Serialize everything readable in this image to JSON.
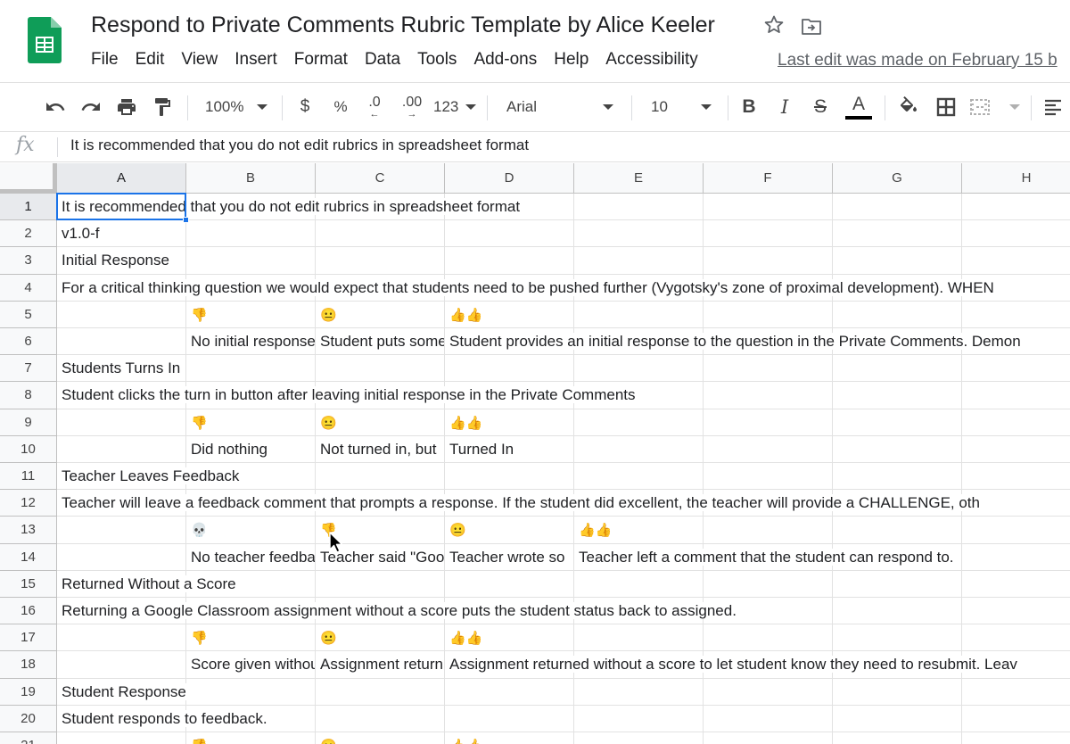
{
  "app": {
    "title": "Respond to Private Comments Rubric Template by Alice Keeler",
    "menu": [
      "File",
      "Edit",
      "View",
      "Insert",
      "Format",
      "Data",
      "Tools",
      "Add-ons",
      "Help",
      "Accessibility"
    ],
    "last_edit": "Last edit was made on February 15 b"
  },
  "toolbar": {
    "zoom": "100%",
    "currency": "$",
    "percent": "%",
    "decrease_decimal": ".0",
    "increase_decimal": ".00",
    "more_formats": "123",
    "font": "Arial",
    "font_size": "10",
    "bold": "B",
    "italic": "I",
    "strike": "S",
    "text_color_glyph": "A"
  },
  "formula_bar": {
    "fx": "fx",
    "value": "It is recommended that you do not edit rubrics in spreadsheet format"
  },
  "grid": {
    "columns": [
      "A",
      "B",
      "C",
      "D",
      "E",
      "F",
      "G",
      "H"
    ],
    "selected_column": "A",
    "selected_row": "1",
    "rows": [
      {
        "n": "1",
        "cells": [
          {
            "col": 0,
            "text": "It is recommended that you do not edit rubrics in spreadsheet format",
            "overflow": true
          }
        ]
      },
      {
        "n": "2",
        "cells": [
          {
            "col": 0,
            "text": "v1.0-f",
            "overflow": true
          }
        ]
      },
      {
        "n": "3",
        "cells": [
          {
            "col": 0,
            "text": "Initial Response",
            "overflow": true
          }
        ]
      },
      {
        "n": "4",
        "cells": [
          {
            "col": 0,
            "text": "For a critical thinking question we would expect that students need to be pushed further (Vygotsky's zone of proximal development). WHEN",
            "overflow": true
          }
        ]
      },
      {
        "n": "5",
        "cells": [
          {
            "col": 1,
            "text": "👎"
          },
          {
            "col": 2,
            "text": "😐"
          },
          {
            "col": 3,
            "text": "👍👍"
          }
        ]
      },
      {
        "n": "6",
        "cells": [
          {
            "col": 1,
            "text": "No initial response"
          },
          {
            "col": 2,
            "text": "Student puts some"
          },
          {
            "col": 3,
            "text": "Student provides an initial response to the question in the Private Comments. Demon",
            "overflow": true
          }
        ]
      },
      {
        "n": "7",
        "cells": [
          {
            "col": 0,
            "text": "Students Turns In",
            "overflow": true
          }
        ]
      },
      {
        "n": "8",
        "cells": [
          {
            "col": 0,
            "text": "Student clicks the turn in button after leaving initial response in the Private Comments",
            "overflow": true
          }
        ]
      },
      {
        "n": "9",
        "cells": [
          {
            "col": 1,
            "text": "👎"
          },
          {
            "col": 2,
            "text": "😐"
          },
          {
            "col": 3,
            "text": "👍👍"
          }
        ]
      },
      {
        "n": "10",
        "cells": [
          {
            "col": 1,
            "text": "Did nothing"
          },
          {
            "col": 2,
            "text": "Not turned in, but"
          },
          {
            "col": 3,
            "text": "Turned In"
          }
        ]
      },
      {
        "n": "11",
        "cells": [
          {
            "col": 0,
            "text": "Teacher Leaves Feedback",
            "overflow": true
          }
        ]
      },
      {
        "n": "12",
        "cells": [
          {
            "col": 0,
            "text": "Teacher will leave a feedback comment that prompts a response. If the student did excellent, the teacher will provide a CHALLENGE, oth",
            "overflow": true
          }
        ]
      },
      {
        "n": "13",
        "cells": [
          {
            "col": 1,
            "text": "💀"
          },
          {
            "col": 2,
            "text": "👎"
          },
          {
            "col": 3,
            "text": "😐"
          },
          {
            "col": 4,
            "text": "👍👍"
          }
        ]
      },
      {
        "n": "14",
        "cells": [
          {
            "col": 1,
            "text": "No teacher feedback"
          },
          {
            "col": 2,
            "text": "Teacher said \"Good"
          },
          {
            "col": 3,
            "text": "Teacher wrote so"
          },
          {
            "col": 4,
            "text": "Teacher left a comment that the student can respond to.",
            "overflow": true
          }
        ]
      },
      {
        "n": "15",
        "cells": [
          {
            "col": 0,
            "text": "Returned Without a Score",
            "overflow": true
          }
        ]
      },
      {
        "n": "16",
        "cells": [
          {
            "col": 0,
            "text": "Returning a Google Classroom assignment without a score puts the student status back to assigned.",
            "overflow": true
          }
        ]
      },
      {
        "n": "17",
        "cells": [
          {
            "col": 1,
            "text": "👎"
          },
          {
            "col": 2,
            "text": "😐"
          },
          {
            "col": 3,
            "text": "👍👍"
          }
        ]
      },
      {
        "n": "18",
        "cells": [
          {
            "col": 1,
            "text": "Score given without"
          },
          {
            "col": 2,
            "text": "Assignment return"
          },
          {
            "col": 3,
            "text": "Assignment returned without a score to let student know they need to resubmit. Leav",
            "overflow": true
          }
        ]
      },
      {
        "n": "19",
        "cells": [
          {
            "col": 0,
            "text": "Student Response",
            "overflow": true
          }
        ]
      },
      {
        "n": "20",
        "cells": [
          {
            "col": 0,
            "text": "Student responds to feedback.",
            "overflow": true
          }
        ]
      },
      {
        "n": "21",
        "cells": [
          {
            "col": 1,
            "text": "👎"
          },
          {
            "col": 2,
            "text": "😐"
          },
          {
            "col": 3,
            "text": "👍👍"
          }
        ]
      }
    ]
  },
  "colors": {
    "accent": "#1a73e8",
    "sheets_green": "#0f9d58"
  }
}
